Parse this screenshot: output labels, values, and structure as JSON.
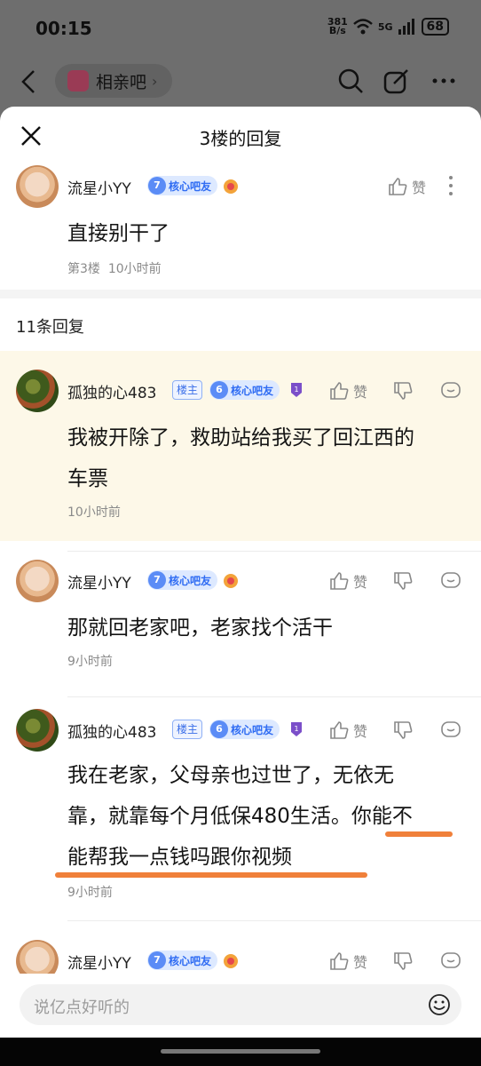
{
  "status": {
    "time": "00:15",
    "speed_top": "381",
    "speed_unit": "B/s",
    "network": "5G",
    "battery": "68"
  },
  "nav": {
    "forum": "相亲吧"
  },
  "sheet": {
    "title": "3楼的回复"
  },
  "original_post": {
    "user": "流星小YY",
    "level": "7",
    "badge": "核心吧友",
    "like_label": "赞",
    "content": "直接别干了",
    "floor": "第3楼",
    "time": "10小时前"
  },
  "reply_count": "11条回复",
  "replies": [
    {
      "user": "孤独的心483",
      "owner": "楼主",
      "level": "6",
      "badge": "核心吧友",
      "like_label": "赞",
      "line1": "我被开除了，救助站给我买了回江西的",
      "line2": "车票",
      "time": "10小时前"
    },
    {
      "user": "流星小YY",
      "level": "7",
      "badge": "核心吧友",
      "like_label": "赞",
      "line1": "那就回老家吧，老家找个活干",
      "time": "9小时前"
    },
    {
      "user": "孤独的心483",
      "owner": "楼主",
      "level": "6",
      "badge": "核心吧友",
      "like_label": "赞",
      "line1": "我在老家，父母亲也过世了，无依无",
      "line2a": "靠，就靠每个月低保480生活。",
      "line2b": "你能不",
      "line3": "能帮我一点钱吗跟你视频",
      "time": "9小时前"
    },
    {
      "user": "流星小YY",
      "level": "7",
      "badge": "核心吧友",
      "like_label": "赞"
    }
  ],
  "input": {
    "placeholder": "说亿点好听的"
  },
  "colors": {
    "highlight_bg": "#fdf8e8",
    "underline": "#f0803a",
    "badge_blue": "#2f6cf3"
  }
}
